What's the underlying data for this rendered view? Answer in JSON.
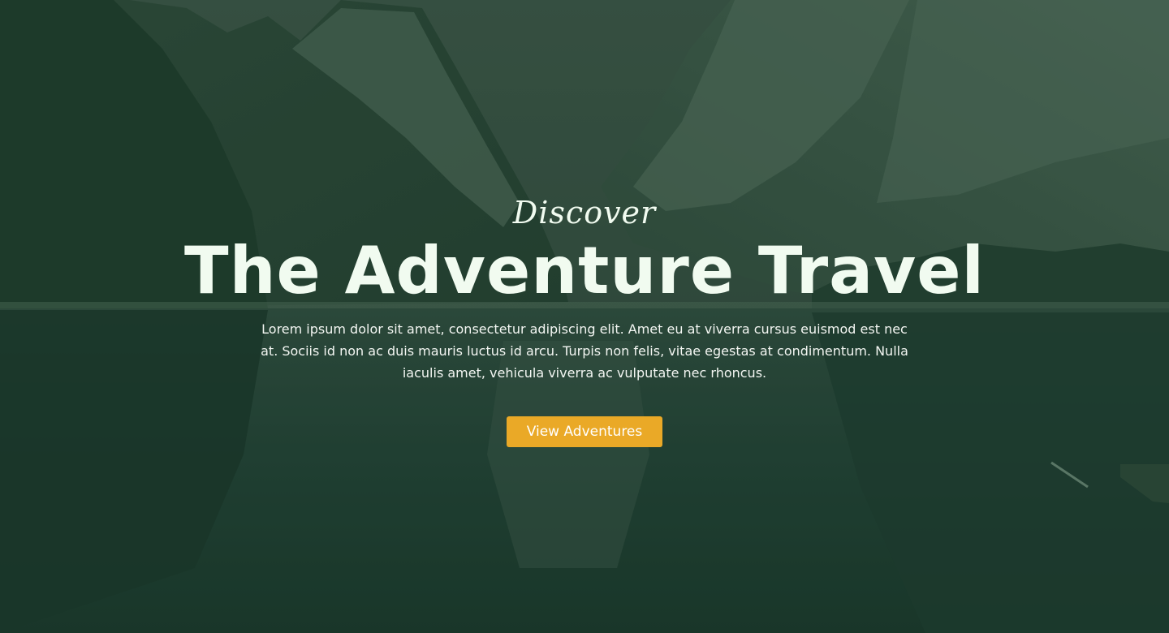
{
  "hero": {
    "kicker": "Discover",
    "title": "The Adventure Travel",
    "description": "Lorem ipsum dolor sit amet, consectetur adipiscing elit. Amet eu at viverra cursus euismod est nec at. Sociis id non ac duis mauris luctus id arcu. Turpis non felis, vitae egestas at condimentum. Nulla iaculis amet, vehicula viverra ac vulputate nec rhoncus.",
    "cta_label": "View Adventures"
  },
  "colors": {
    "overlay": "#1f3a2d",
    "text": "#f1fbf0",
    "accent": "#eaa927"
  }
}
